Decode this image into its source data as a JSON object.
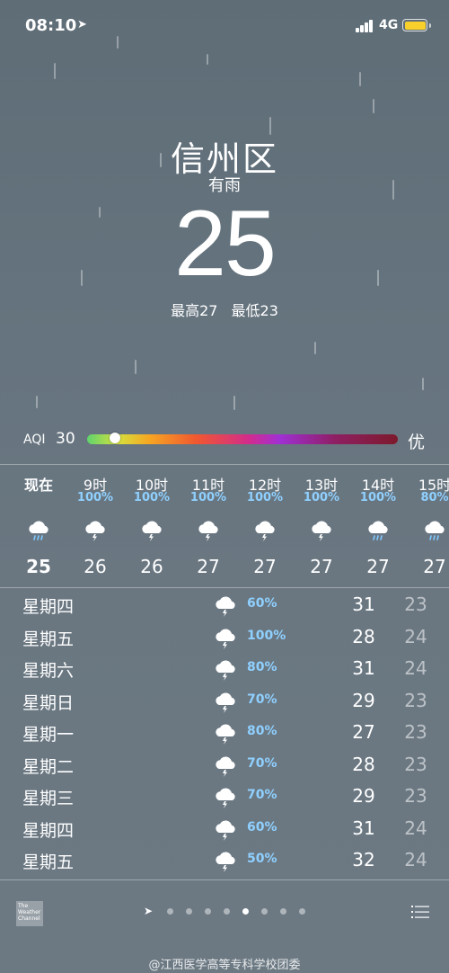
{
  "status_bar": {
    "time": "08:10",
    "network": "4G"
  },
  "location": {
    "city": "信州区",
    "condition": "有雨",
    "temperature": "25",
    "high": "最高27",
    "low": "最低23"
  },
  "aqi": {
    "label": "AQI",
    "value": "30",
    "level": "优",
    "level_fraction": 0.09
  },
  "hourly": [
    {
      "time": "现在",
      "prob": "",
      "temp": "25",
      "icon": "cloud-rain-icon"
    },
    {
      "time": "9时",
      "prob": "100%",
      "temp": "26",
      "icon": "cloud-thunderstorm-icon"
    },
    {
      "time": "10时",
      "prob": "100%",
      "temp": "26",
      "icon": "cloud-thunderstorm-icon"
    },
    {
      "time": "11时",
      "prob": "100%",
      "temp": "27",
      "icon": "cloud-thunderstorm-icon"
    },
    {
      "time": "12时",
      "prob": "100%",
      "temp": "27",
      "icon": "cloud-thunderstorm-icon"
    },
    {
      "time": "13时",
      "prob": "100%",
      "temp": "27",
      "icon": "cloud-thunderstorm-icon"
    },
    {
      "time": "14时",
      "prob": "100%",
      "temp": "27",
      "icon": "cloud-rain-icon"
    },
    {
      "time": "15时",
      "prob": "80%",
      "temp": "27",
      "icon": "cloud-rain-icon"
    }
  ],
  "daily": [
    {
      "day": "星期四",
      "prob": "60%",
      "high": "31",
      "low": "23"
    },
    {
      "day": "星期五",
      "prob": "100%",
      "high": "28",
      "low": "24"
    },
    {
      "day": "星期六",
      "prob": "80%",
      "high": "31",
      "low": "24"
    },
    {
      "day": "星期日",
      "prob": "70%",
      "high": "29",
      "low": "23"
    },
    {
      "day": "星期一",
      "prob": "80%",
      "high": "27",
      "low": "23"
    },
    {
      "day": "星期二",
      "prob": "70%",
      "high": "28",
      "low": "23"
    },
    {
      "day": "星期三",
      "prob": "70%",
      "high": "29",
      "low": "23"
    },
    {
      "day": "星期四",
      "prob": "60%",
      "high": "31",
      "low": "24"
    },
    {
      "day": "星期五",
      "prob": "50%",
      "high": "32",
      "low": "24"
    }
  ],
  "bottom": {
    "provider": "The Weather Channel",
    "page_count": 8,
    "active_page": 4
  },
  "watermark": "@江西医学高等专科学校团委"
}
